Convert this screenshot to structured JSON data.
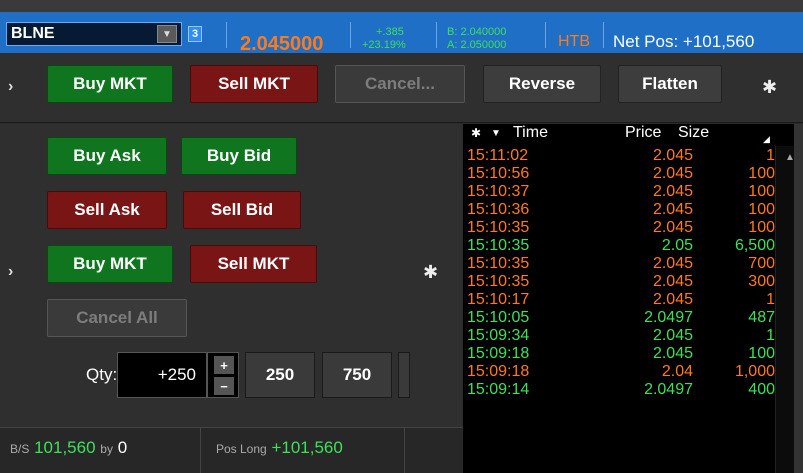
{
  "header": {
    "symbol": "BLNE",
    "link_badge": "3",
    "last_price": "2.045000",
    "change_abs": "+.385",
    "change_pct": "+23.19%",
    "bid": "B: 2.040000",
    "ask": "A: 2.050000",
    "htb": "HTB",
    "net_pos": "Net Pos: +101,560"
  },
  "toolbar": {
    "buy_mkt": "Buy MKT",
    "sell_mkt": "Sell MKT",
    "cancel": "Cancel...",
    "reverse": "Reverse",
    "flatten": "Flatten"
  },
  "order_panel": {
    "buy_ask": "Buy Ask",
    "buy_bid": "Buy Bid",
    "sell_ask": "Sell Ask",
    "sell_bid": "Sell Bid",
    "buy_mkt": "Buy MKT",
    "sell_mkt": "Sell MKT",
    "cancel_all": "Cancel All",
    "qty_label": "Qty:",
    "qty_value": "+250",
    "qty_plus": "+",
    "qty_minus": "−",
    "preset_1": "250",
    "preset_2": "750"
  },
  "status": {
    "bs_label": "B/S",
    "bs_value": "101,560",
    "by_label": "by",
    "by_value": "0",
    "pos_label": "Pos Long",
    "pos_value": "+101,560"
  },
  "time_sales": {
    "headers": {
      "time": "Time",
      "price": "Price",
      "size": "Size"
    },
    "rows": [
      {
        "time": "15:11:02",
        "price": "2.045",
        "size": "1",
        "side": "orange"
      },
      {
        "time": "15:10:56",
        "price": "2.045",
        "size": "100",
        "side": "orange"
      },
      {
        "time": "15:10:37",
        "price": "2.045",
        "size": "100",
        "side": "orange"
      },
      {
        "time": "15:10:36",
        "price": "2.045",
        "size": "100",
        "side": "orange"
      },
      {
        "time": "15:10:35",
        "price": "2.045",
        "size": "100",
        "side": "orange"
      },
      {
        "time": "15:10:35",
        "price": "2.05",
        "size": "6,500",
        "side": "lime"
      },
      {
        "time": "15:10:35",
        "price": "2.045",
        "size": "700",
        "side": "orange"
      },
      {
        "time": "15:10:35",
        "price": "2.045",
        "size": "300",
        "side": "orange"
      },
      {
        "time": "15:10:17",
        "price": "2.045",
        "size": "1",
        "side": "orange"
      },
      {
        "time": "15:10:05",
        "price": "2.0497",
        "size": "487",
        "side": "lime"
      },
      {
        "time": "15:09:34",
        "price": "2.045",
        "size": "1",
        "side": "lime"
      },
      {
        "time": "15:09:18",
        "price": "2.045",
        "size": "100",
        "side": "lime"
      },
      {
        "time": "15:09:18",
        "price": "2.04",
        "size": "1,000",
        "side": "orange"
      },
      {
        "time": "15:09:14",
        "price": "2.0497",
        "size": "400",
        "side": "lime"
      }
    ]
  },
  "colors": {
    "accent": "#1f6fc7",
    "buy": "#10751f",
    "sell": "#7a1515",
    "uptick": "#3ee05a",
    "downtick": "#ff7a1a"
  }
}
